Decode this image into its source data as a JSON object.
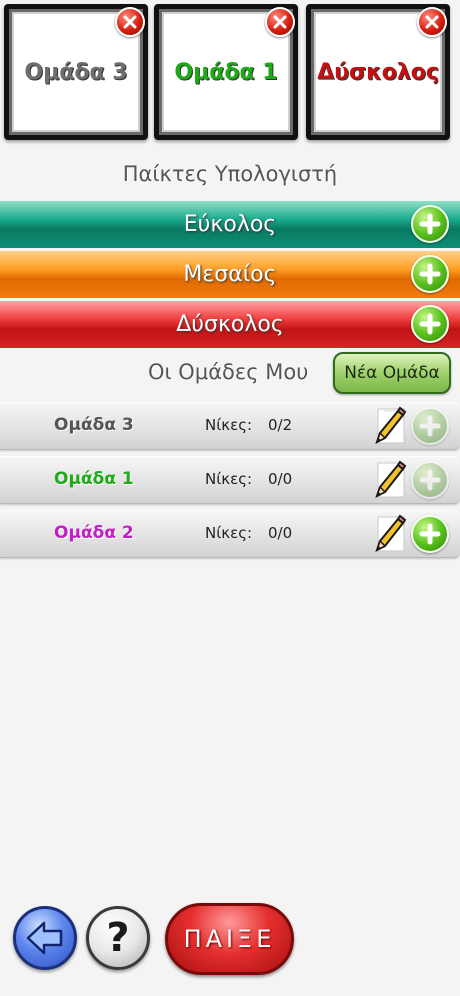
{
  "selected_teams": [
    {
      "label": "Ομάδα 3",
      "color": "#6e6e6e"
    },
    {
      "label": "Ομάδα 1",
      "color": "#1faa1a"
    },
    {
      "label": "Δύσκολος",
      "color": "#c41010"
    }
  ],
  "computer_players": {
    "title": "Παίκτες Υπολογιστή",
    "levels": [
      {
        "label": "Εύκολος",
        "icon": "plus-icon"
      },
      {
        "label": "Μεσαίος",
        "icon": "plus-icon"
      },
      {
        "label": "Δύσκολος",
        "icon": "plus-icon"
      }
    ]
  },
  "my_teams": {
    "title": "Οι Ομάδες Μου",
    "new_team_label": "Νέα Ομάδα",
    "wins_label": "Νίκες:",
    "teams": [
      {
        "name": "Ομάδα 3",
        "wins": "0/2",
        "color": "#555555",
        "add_enabled": false
      },
      {
        "name": "Ομάδα 1",
        "wins": "0/0",
        "color": "#1faa1a",
        "add_enabled": false
      },
      {
        "name": "Ομάδα 2",
        "wins": "0/0",
        "color": "#c21fc2",
        "add_enabled": true
      }
    ]
  },
  "bottom_bar": {
    "help_label": "?",
    "play_label": "ΠΑΙΞΕ"
  },
  "icons": {
    "remove": "close-icon",
    "add": "plus-icon",
    "edit": "pencil-icon",
    "back": "back-arrow-icon"
  }
}
